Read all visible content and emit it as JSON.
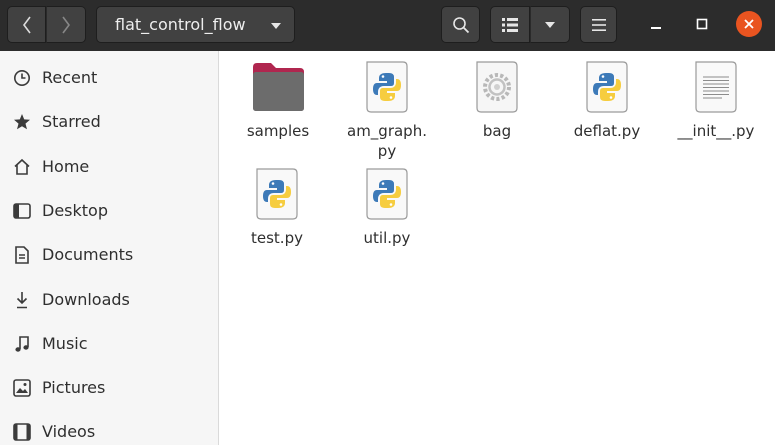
{
  "header": {
    "path_label": "flat_control_flow",
    "buttons": {
      "back": "back-icon",
      "forward": "forward-icon",
      "search": "search-icon",
      "view": "list-view-icon",
      "view_menu": "chevron-down-icon",
      "menu": "hamburger-menu-icon"
    }
  },
  "window_controls": {
    "close_color": "#e95420"
  },
  "sidebar": {
    "items": [
      {
        "label": "Recent",
        "icon": "clock-icon"
      },
      {
        "label": "Starred",
        "icon": "star-icon"
      },
      {
        "label": "Home",
        "icon": "home-icon"
      },
      {
        "label": "Desktop",
        "icon": "desktop-icon"
      },
      {
        "label": "Documents",
        "icon": "document-icon"
      },
      {
        "label": "Downloads",
        "icon": "download-icon"
      },
      {
        "label": "Music",
        "icon": "music-icon"
      },
      {
        "label": "Pictures",
        "icon": "pictures-icon"
      },
      {
        "label": "Videos",
        "icon": "videos-icon"
      }
    ]
  },
  "files": [
    {
      "name": "samples",
      "icon": "folder-icon"
    },
    {
      "name": "am_graph.py",
      "name_line1": "am_graph.",
      "name_line2": "py",
      "icon": "python-file-icon"
    },
    {
      "name": "bag",
      "icon": "executable-file-icon"
    },
    {
      "name": "deflat.py",
      "icon": "python-file-icon"
    },
    {
      "name": "__init__.py",
      "icon": "text-file-icon"
    },
    {
      "name": "test.py",
      "icon": "python-file-icon"
    },
    {
      "name": "util.py",
      "icon": "python-file-icon"
    }
  ],
  "colors": {
    "header_bg": "#2c2c2c",
    "accent": "#e95420",
    "folder_body": "#6c6c6c",
    "folder_tab": "#b0264f",
    "python_blue": "#3d7ab8",
    "python_yellow": "#f6cd3f"
  }
}
